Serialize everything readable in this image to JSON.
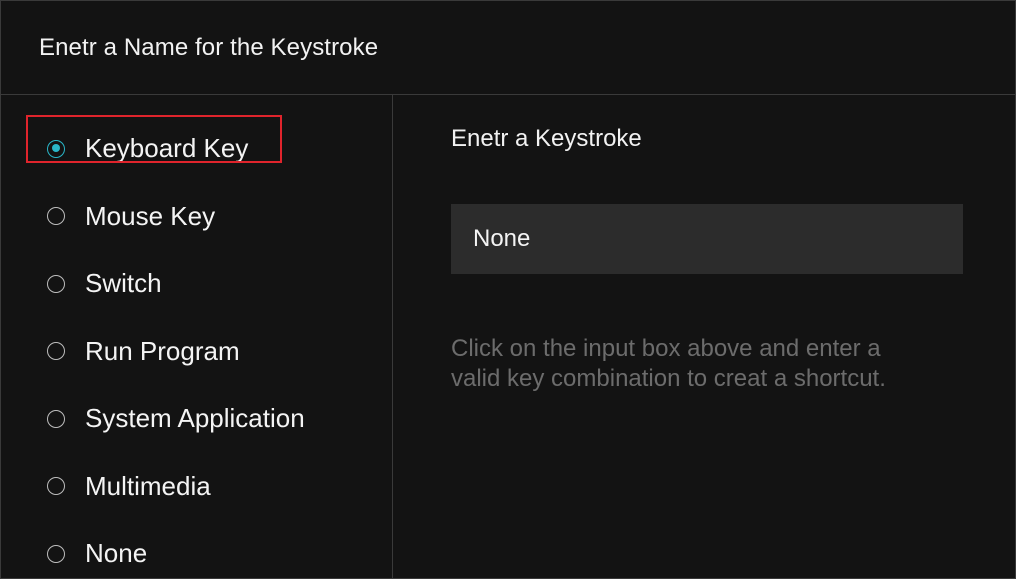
{
  "header": {
    "title": "Enetr a Name for the Keystroke"
  },
  "sidebar": {
    "selected_index": 0,
    "options": [
      {
        "label": "Keyboard Key",
        "selected": true
      },
      {
        "label": "Mouse Key",
        "selected": false
      },
      {
        "label": "Switch",
        "selected": false
      },
      {
        "label": "Run Program",
        "selected": false
      },
      {
        "label": "System Application",
        "selected": false
      },
      {
        "label": "Multimedia",
        "selected": false
      },
      {
        "label": "None",
        "selected": false
      }
    ]
  },
  "main": {
    "section_title": "Enetr a Keystroke",
    "input_value": "None",
    "hint": "Click on the input box above and enter a valid key combination to creat a shortcut."
  },
  "colors": {
    "background": "#131313",
    "accent": "#29b6c8",
    "highlight_border": "#e0242c",
    "input_background": "#2c2c2c",
    "hint_text": "#6c6c6c"
  }
}
